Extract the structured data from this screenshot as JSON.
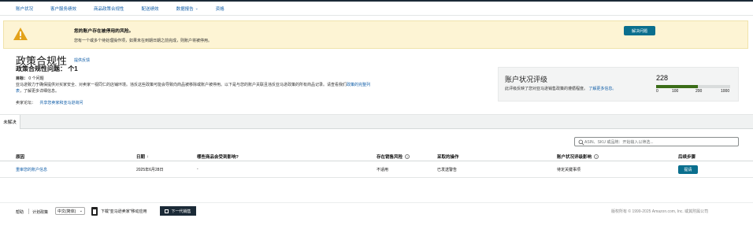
{
  "nav": {
    "items": [
      {
        "label": "账户状况"
      },
      {
        "label": "客户服务绩效"
      },
      {
        "label": "商品政策合规性"
      },
      {
        "label": "配送绩效"
      },
      {
        "label": "数据报告",
        "has_dropdown": true
      },
      {
        "label": "资格"
      }
    ]
  },
  "alert": {
    "title": "您的账户存在被停用的风险。",
    "text": "您有一个或多个待处理操作项，如果未在到期日期之前完成，则账户将被停用。",
    "button": "解决问题"
  },
  "header": {
    "title": "政策合规性",
    "learn_more": "提供反馈",
    "issues": "政策合规性问题： 个1",
    "target_label": "目标：",
    "target_value": "0 个问题",
    "desc_text": "亚马逊致力于确保提供对买家安全、对卖家一视同仁的店铺环境。违反这些政策可能会导致向商品被移除或账户被停用。以下是与您的账户关联且违反亚马逊政策的所有商品记录。请查看我们",
    "desc_link": "政策的完整列表",
    "desc_suffix": "，了解更多详细信息。",
    "forum_label": "卖家论坛：",
    "forum_link": "共享您卖家和亚马逊询问"
  },
  "health": {
    "title": "账户状况评级",
    "desc": "此评级反映了您对亚马逊销售政策的遵循程度。",
    "learn_more": "了解更多信息。",
    "score": "228",
    "score_value": 228,
    "scale_max": 1000,
    "ticks": [
      "0",
      "100",
      "200",
      "1000"
    ],
    "fill_color": "#3b6d18"
  },
  "tabs": [
    {
      "label": "未解决"
    }
  ],
  "search": {
    "placeholder": "ASIN、SKU 或品牌：开始输入以筛选..."
  },
  "table": {
    "headers": [
      {
        "label": "原因"
      },
      {
        "label": "日期",
        "sort": "↓"
      },
      {
        "label": "哪些商品会受到影响?"
      },
      {
        "label": "存在销售风险",
        "help": "?"
      },
      {
        "label": "采取的操作"
      },
      {
        "label": "账户状况评级影响",
        "help": "?"
      },
      {
        "label": "后续步骤"
      }
    ],
    "rows": [
      {
        "reason": "重审您的账户信息",
        "date": "2025年6月28日",
        "affected": "-",
        "sales_risk": "不适用",
        "action": "已发送警告",
        "impact": "待定关键事项",
        "next_step": "提请"
      }
    ]
  },
  "footer": {
    "help": "帮助",
    "policy": "计划政策",
    "language": "中文(简体)",
    "app": "下载\"亚马逊卖家\"移动应用",
    "next_gen": "下一代销售",
    "copyright": "版权所有 © 1999-2025 Amazon.com, Inc. 或其附属公司"
  },
  "colors": {
    "brand_teal": "#0a6f8e",
    "link": "#0f5da8",
    "alert_bg": "#fdf4d4",
    "dark": "#1b2a37"
  }
}
